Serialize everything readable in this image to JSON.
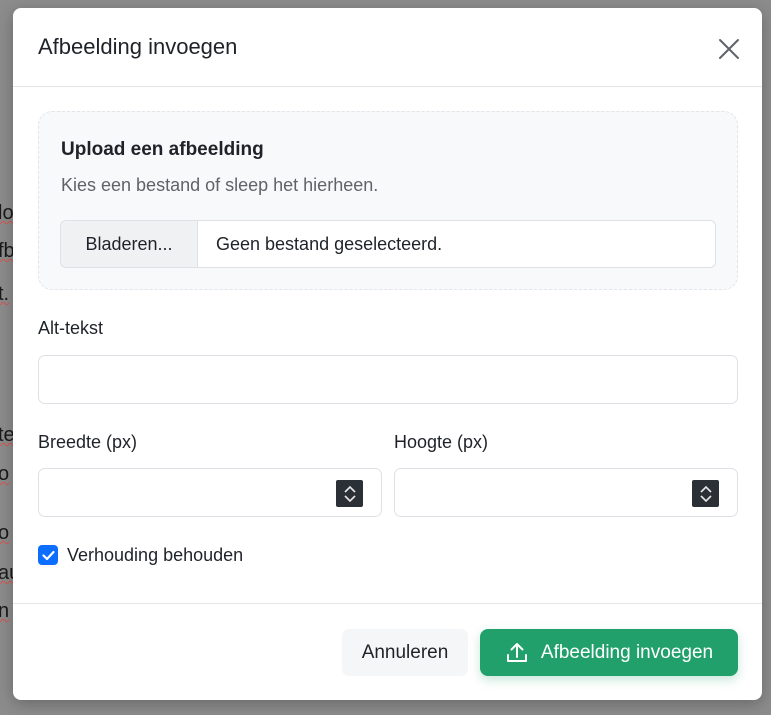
{
  "background": {
    "fragments": [
      "lo",
      "fb",
      "t.",
      "te",
      "o",
      "o",
      "au",
      "n"
    ]
  },
  "dialog": {
    "title": "Afbeelding invoegen",
    "close_icon": "close-icon"
  },
  "upload": {
    "title": "Upload een afbeelding",
    "description": "Kies een bestand of sleep het hierheen.",
    "browse_label": "Bladeren...",
    "file_status": "Geen bestand geselecteerd."
  },
  "alt_text": {
    "label": "Alt-tekst",
    "value": ""
  },
  "width": {
    "label": "Breedte (px)",
    "value": ""
  },
  "height": {
    "label": "Hoogte (px)",
    "value": ""
  },
  "aspect": {
    "label": "Verhouding behouden",
    "checked": true
  },
  "footer": {
    "cancel_label": "Annuleren",
    "insert_label": "Afbeelding invoegen",
    "insert_icon": "upload-icon"
  },
  "colors": {
    "primary_green": "#22a06b",
    "checkbox_blue": "#0d6efd",
    "overlay": "#8c8c8c"
  }
}
